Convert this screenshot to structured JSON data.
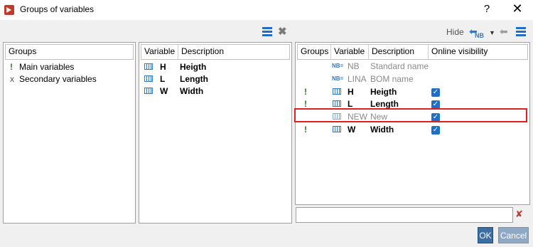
{
  "window": {
    "title": "Groups of variables",
    "help_label": "?",
    "close_label": "✕"
  },
  "toolbar_right": {
    "hide_label": "Hide",
    "nb_label": "NB"
  },
  "groups_panel": {
    "header": "Groups",
    "items": [
      {
        "mark": "!",
        "label": "Main variables"
      },
      {
        "mark": "x",
        "label": "Secondary variables"
      }
    ]
  },
  "variables_panel": {
    "headers": {
      "variable": "Variable",
      "description": "Description"
    },
    "rows": [
      {
        "variable": "H",
        "description": "Heigth"
      },
      {
        "variable": "L",
        "description": "Length"
      },
      {
        "variable": "W",
        "description": "Width"
      }
    ]
  },
  "detail_panel": {
    "headers": {
      "groups": "Groups",
      "variable": "Variable",
      "description": "Description",
      "online_visibility": "Online visibility"
    },
    "rows": [
      {
        "group": "",
        "icon": "NB",
        "variable": "NB",
        "description": "Standard name",
        "checked": false,
        "style": "gray"
      },
      {
        "group": "",
        "icon": "NB",
        "variable": "LINA",
        "description": "BOM name",
        "checked": false,
        "style": "gray"
      },
      {
        "group": "!",
        "icon": "var",
        "variable": "H",
        "description": "Heigth",
        "checked": true,
        "style": "bold"
      },
      {
        "group": "!",
        "icon": "var",
        "variable": "L",
        "description": "Length",
        "checked": true,
        "style": "bold"
      },
      {
        "group": "",
        "icon": "var",
        "variable": "NEW",
        "description": "New",
        "checked": true,
        "style": "gray"
      },
      {
        "group": "!",
        "icon": "var",
        "variable": "W",
        "description": "Width",
        "checked": true,
        "style": "bold"
      }
    ]
  },
  "buttons": {
    "ok": "OK",
    "cancel": "Cancel"
  },
  "colors": {
    "accent": "#1f6fc8",
    "highlight": "#e02020",
    "ok_bg": "#3a6ea5",
    "cancel_bg": "#8fa8c4"
  }
}
